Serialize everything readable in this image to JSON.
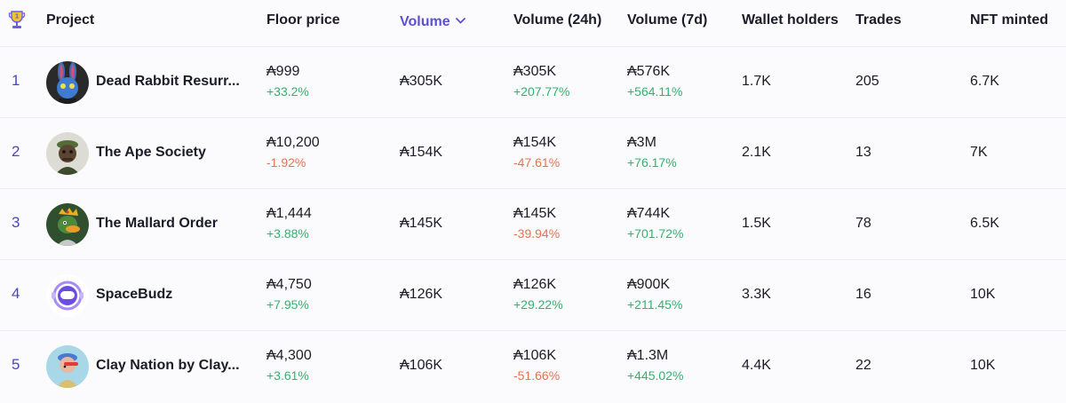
{
  "header": {
    "trophy_icon": "trophy-icon",
    "project": "Project",
    "floor_price": "Floor price",
    "volume": "Volume",
    "volume_24h": "Volume (24h)",
    "volume_7d": "Volume (7d)",
    "wallet_holders": "Wallet holders",
    "trades": "Trades",
    "nft_minted": "NFT minted"
  },
  "colors": {
    "accent": "#5b4fd6",
    "positive": "#2fb36b",
    "negative": "#e8704d"
  },
  "rows": [
    {
      "rank": "1",
      "name": "Dead Rabbit Resurr...",
      "floor": "₳999",
      "floor_change": "+33.2%",
      "volume": "₳305K",
      "vol24": "₳305K",
      "vol24_change": "+207.77%",
      "vol7": "₳576K",
      "vol7_change": "+564.11%",
      "holders": "1.7K",
      "trades": "205",
      "minted": "6.7K"
    },
    {
      "rank": "2",
      "name": "The Ape Society",
      "floor": "₳10,200",
      "floor_change": "-1.92%",
      "volume": "₳154K",
      "vol24": "₳154K",
      "vol24_change": "-47.61%",
      "vol7": "₳3M",
      "vol7_change": "+76.17%",
      "holders": "2.1K",
      "trades": "13",
      "minted": "7K"
    },
    {
      "rank": "3",
      "name": "The Mallard Order",
      "floor": "₳1,444",
      "floor_change": "+3.88%",
      "volume": "₳145K",
      "vol24": "₳145K",
      "vol24_change": "-39.94%",
      "vol7": "₳744K",
      "vol7_change": "+701.72%",
      "holders": "1.5K",
      "trades": "78",
      "minted": "6.5K"
    },
    {
      "rank": "4",
      "name": "SpaceBudz",
      "floor": "₳4,750",
      "floor_change": "+7.95%",
      "volume": "₳126K",
      "vol24": "₳126K",
      "vol24_change": "+29.22%",
      "vol7": "₳900K",
      "vol7_change": "+211.45%",
      "holders": "3.3K",
      "trades": "16",
      "minted": "10K"
    },
    {
      "rank": "5",
      "name": "Clay Nation by Clay...",
      "floor": "₳4,300",
      "floor_change": "+3.61%",
      "volume": "₳106K",
      "vol24": "₳106K",
      "vol24_change": "-51.66%",
      "vol7": "₳1.3M",
      "vol7_change": "+445.02%",
      "holders": "4.4K",
      "trades": "22",
      "minted": "10K"
    }
  ]
}
